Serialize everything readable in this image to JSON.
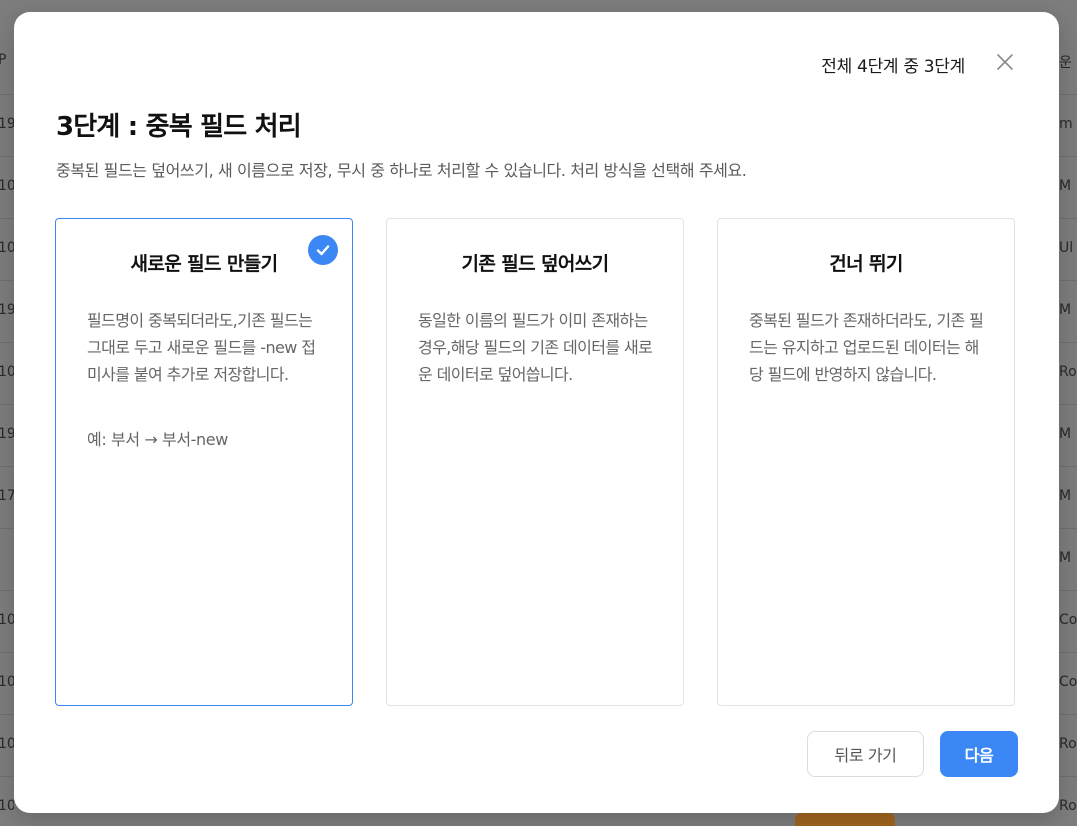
{
  "background": {
    "left_cells": [
      "P",
      "19",
      "10",
      "10",
      "19",
      "10",
      "19",
      "17",
      "",
      "10",
      "10",
      "10",
      "10"
    ],
    "right_cells": [
      "운",
      "m",
      "M",
      "Ul",
      "M",
      "Ro",
      "M",
      "M",
      "M",
      "Co",
      "Co",
      "Ro",
      "Ro"
    ]
  },
  "modal": {
    "step_indicator": "전체 4단계 중 3단계",
    "close_icon": "close-icon",
    "title": "3단계 : 중복 필드 처리",
    "description": "중복된 필드는 덮어쓰기, 새 이름으로 저장, 무시 중 하나로 처리할 수 있습니다. 처리 방식을 선택해 주세요.",
    "options": [
      {
        "title": "새로운 필드 만들기",
        "body": "필드명이 중복되더라도,기존 필드는 그대로 두고 새로운 필드를 -new 접미사를 붙여 추가로 저장합니다.",
        "example": "예: 부서 → 부서-new",
        "selected": true,
        "icon": "check-circle-icon"
      },
      {
        "title": "기존 필드 덮어쓰기",
        "body": "동일한 이름의 필드가 이미 존재하는 경우,해당 필드의 기존 데이터를 새로운 데이터로 덮어씁니다.",
        "selected": false
      },
      {
        "title": "건너 뛰기",
        "body": "중복된 필드가 존재하더라도, 기존 필드는 유지하고 업로드된 데이터는 해당 필드에 반영하지 않습니다.",
        "selected": false
      }
    ],
    "footer": {
      "back_label": "뒤로 가기",
      "next_label": "다음"
    }
  },
  "colors": {
    "accent": "#3b87f5",
    "overlay": "#7d7d7d",
    "text_primary": "#111111",
    "text_secondary": "#666666"
  }
}
